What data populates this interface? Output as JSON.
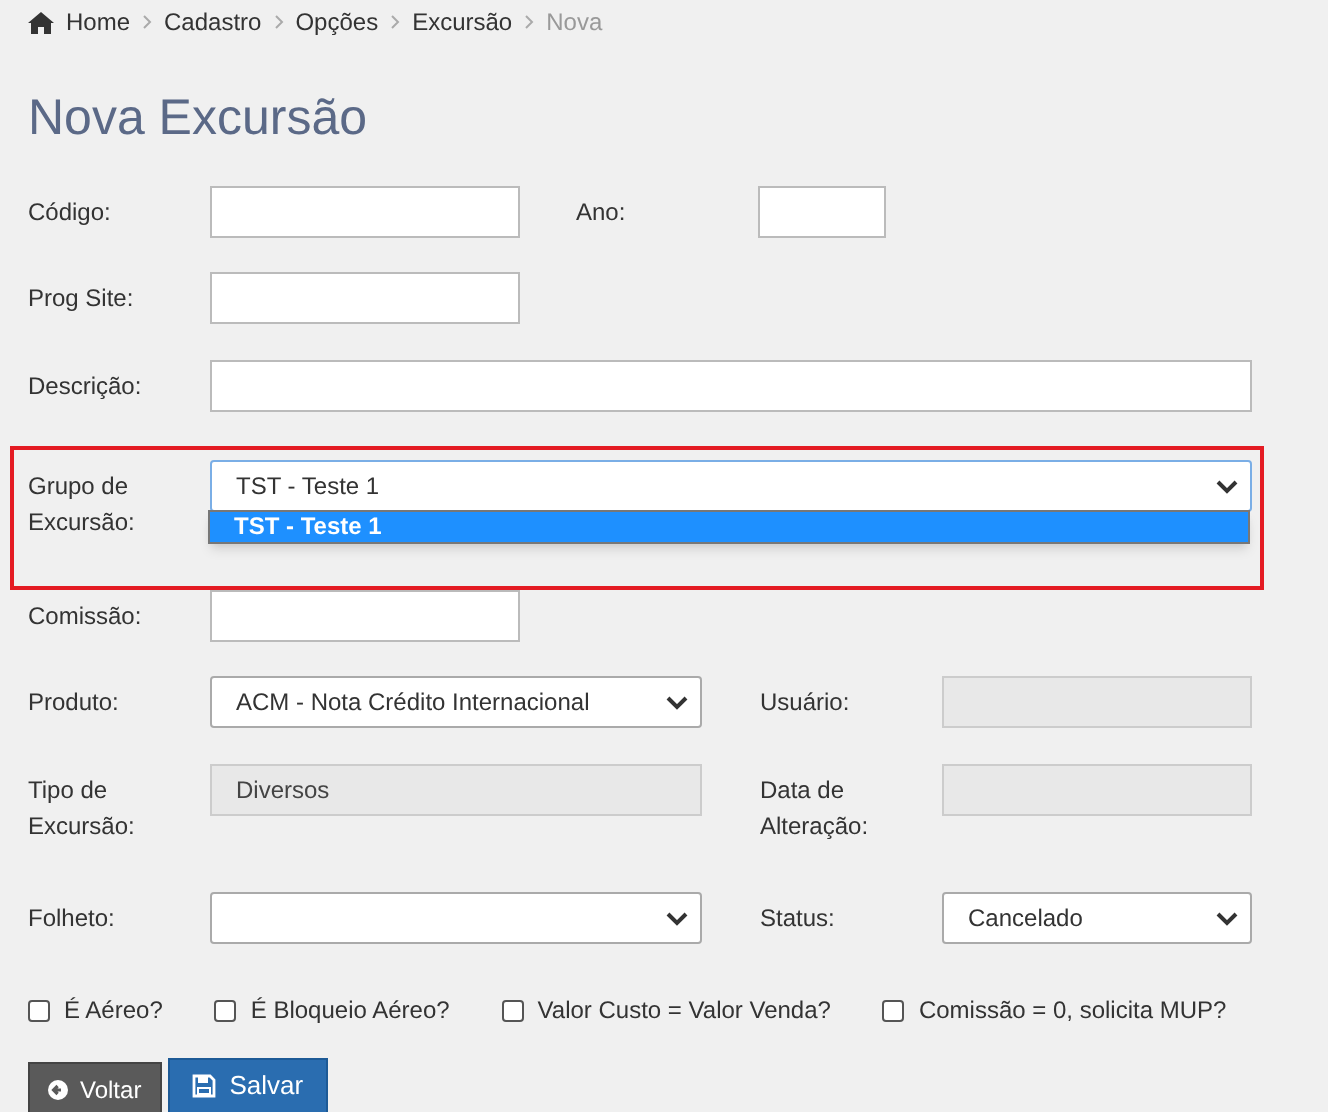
{
  "breadcrumb": [
    {
      "label": "Home",
      "current": false
    },
    {
      "label": "Cadastro",
      "current": false
    },
    {
      "label": "Opções",
      "current": false
    },
    {
      "label": "Excursão",
      "current": false
    },
    {
      "label": "Nova",
      "current": true
    }
  ],
  "title": "Nova Excursão",
  "rows": [
    {
      "fields": [
        {
          "label": "Código:",
          "kind": "text"
        },
        {
          "label": "Ano:",
          "kind": "text"
        }
      ]
    },
    {
      "fields": [
        {
          "label": "Prog Site:",
          "kind": "text"
        }
      ]
    },
    {
      "fields": [
        {
          "label": "Descrição:",
          "kind": "text"
        }
      ]
    },
    {
      "highlighted": true,
      "fields": [
        {
          "label": "Grupo de Excursão:",
          "kind": "select",
          "value": "TST - Teste 1",
          "expanded": true,
          "options": [
            {
              "label": "TST - Teste 1",
              "selected": true
            }
          ]
        }
      ]
    },
    {
      "fields": [
        {
          "label": "Comissão:",
          "kind": "text"
        }
      ]
    },
    {
      "fields": [
        {
          "label": "Produto:",
          "kind": "select",
          "value": "ACM - Nota Crédito Internacional"
        },
        {
          "label": "Usuário:",
          "kind": "readonly"
        }
      ]
    },
    {
      "fields": [
        {
          "label": "Tipo de Excursão:",
          "kind": "readonly",
          "value": "Diversos"
        },
        {
          "label": "Data de Alteração:",
          "kind": "readonly"
        }
      ]
    },
    {
      "fields": [
        {
          "label": "Folheto:",
          "kind": "select"
        },
        {
          "label": "Status:",
          "kind": "select",
          "value": "Cancelado"
        }
      ]
    }
  ],
  "checkboxes": [
    {
      "label": "É Aéreo?",
      "checked": false
    },
    {
      "label": "É Bloqueio Aéreo?",
      "checked": false
    },
    {
      "label": "Valor Custo = Valor Venda?",
      "checked": false
    },
    {
      "label": "Comissão = 0, solicita MUP?",
      "checked": false
    }
  ],
  "buttons": [
    {
      "label": "Voltar",
      "kind": "back"
    },
    {
      "label": "Salvar",
      "kind": "save"
    }
  ]
}
